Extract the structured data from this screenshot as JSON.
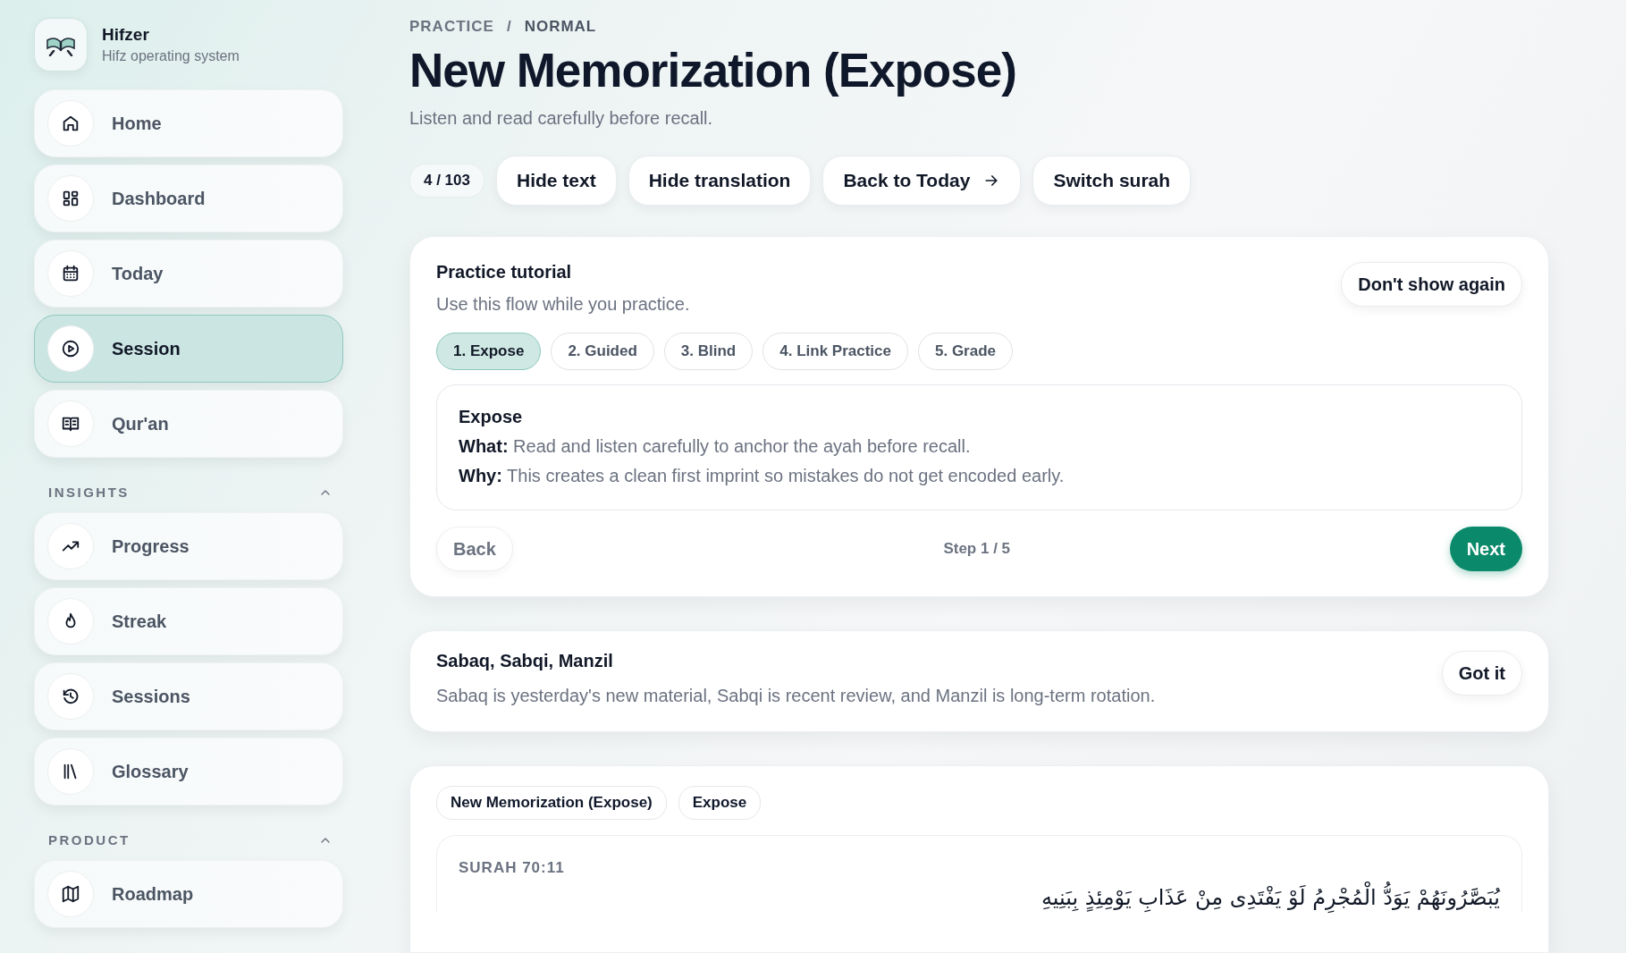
{
  "brand": {
    "name": "Hifzer",
    "tagline": "Hifz operating system"
  },
  "nav": [
    {
      "label": "Home",
      "selected": false
    },
    {
      "label": "Dashboard",
      "selected": false
    },
    {
      "label": "Today",
      "selected": false
    },
    {
      "label": "Session",
      "selected": true
    },
    {
      "label": "Qur'an",
      "selected": false
    }
  ],
  "nav_sections": [
    {
      "title": "INSIGHTS",
      "expanded": true,
      "items": [
        {
          "label": "Progress",
          "selected": false
        },
        {
          "label": "Streak",
          "selected": false
        },
        {
          "label": "Sessions",
          "selected": false
        },
        {
          "label": "Glossary",
          "selected": false
        }
      ]
    },
    {
      "title": "PRODUCT",
      "expanded": true,
      "items": [
        {
          "label": "Roadmap",
          "selected": false
        }
      ]
    }
  ],
  "breadcrumb": {
    "items": [
      "PRACTICE",
      "NORMAL"
    ],
    "separator": "/"
  },
  "title": "New Memorization (Expose)",
  "subtitle": "Listen and read carefully before recall.",
  "toolbar": {
    "counter": "4 / 103",
    "buttons": [
      {
        "label": "Hide text",
        "kind": "plain"
      },
      {
        "label": "Hide translation",
        "kind": "plain"
      },
      {
        "label": "Back to Today",
        "kind": "link"
      },
      {
        "label": "Switch surah",
        "kind": "plain"
      }
    ]
  },
  "tutorial": {
    "title": "Practice tutorial",
    "subtitle": "Use this flow while you practice.",
    "dismiss": "Don't show again",
    "steps": [
      {
        "label": "1. Expose",
        "selected": true
      },
      {
        "label": "2. Guided",
        "selected": false
      },
      {
        "label": "3. Blind",
        "selected": false
      },
      {
        "label": "4. Link Practice",
        "selected": false
      },
      {
        "label": "5. Grade",
        "selected": false
      }
    ],
    "detail": {
      "heading": "Expose",
      "lines": [
        "**What:** Read and listen carefully to anchor the ayah before recall.",
        "**Why:** This creates a clean first imprint so mistakes do not get encoded early."
      ]
    },
    "back": "Back",
    "step": "Step 1 / 5",
    "next": "Next"
  },
  "info": {
    "title": "Sabaq, Sabqi, Manzil",
    "text": "Sabaq is yesterday's new material, Sabqi is recent review, and Manzil is long-term rotation.",
    "button": "Got it"
  },
  "ayah": {
    "tags": [
      "New Memorization (Expose)",
      "Expose"
    ],
    "reference": "SURAH 70:11",
    "arabic": "يُبَصَّرُونَهُمْ يَوَدُّ الْمُجْرِمُ لَوْ يَفْتَدِى مِنْ عَذَابِ يَوْمِئِذٍ بِبَنِيهِ"
  }
}
